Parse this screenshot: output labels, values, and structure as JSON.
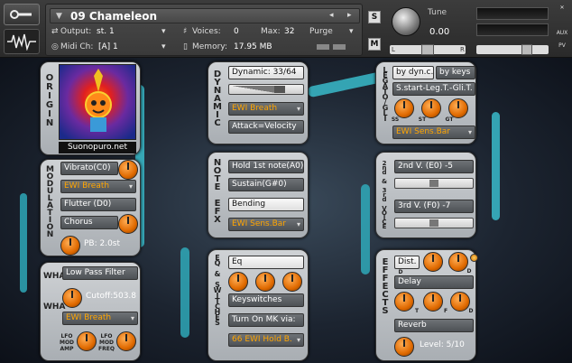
{
  "header": {
    "instrument_name": "09 Chameleon",
    "output_label": "Output:",
    "output_value": "st. 1",
    "midi_label": "Midi Ch:",
    "midi_value": "[A]  1",
    "voices_label": "Voices:",
    "voices_value": "0",
    "max_label": "Max:",
    "max_value": "32",
    "memory_label": "Memory:",
    "memory_value": "17.95 MB",
    "purge_label": "Purge",
    "solo_label": "S",
    "mute_label": "M",
    "tune_label": "Tune",
    "tune_value": "0.00",
    "pan_left": "L",
    "pan_right": "R",
    "aux_label": "AUX",
    "pv_label": "PV",
    "nav_prev": "◂",
    "nav_next": "▸"
  },
  "origin": {
    "title": "ORIGIN",
    "website": "Suonopuro.net"
  },
  "modulation": {
    "title": "MODULATION",
    "vibrato": "Vibrato(C0)",
    "ewi_breath": "EWI Breath",
    "flutter": "Flutter (D0)",
    "chorus": "Chorus",
    "pb": "PB:  2.0st"
  },
  "wha": {
    "title_1": "WHA",
    "title_2": "WHA",
    "low_pass_filter": "Low Pass Filter",
    "cutoff": "Cutoff:503.8",
    "ewi_breath": "EWI Breath",
    "lfo_mod_amp": "LFO MOD AMP",
    "lfo_mod_freq": "LFO MOD FREQ"
  },
  "dynamic": {
    "title": "DYNAMIC",
    "dynamic_value": "Dynamic: 33/64",
    "ewi_breath": "EWI Breath",
    "attack": "Attack=Velocity"
  },
  "note_efx": {
    "title": "NOTE EFX",
    "hold_1st_note": "Hold 1st note(A0)",
    "sustain": "Sustain(G#0)",
    "bending": "Bending",
    "ewi_sens_bar": "EWI Sens.Bar"
  },
  "eq_switches": {
    "title": "EQ & SWITCHES",
    "eq": "Eq",
    "keyswitches": "Keyswitches",
    "turn_on_mk": "Turn On MK via:",
    "ewi_hold": "66 EWI Hold B."
  },
  "legato": {
    "title": "LEGATO/GLI",
    "by_dyn": "by dyn.c.",
    "by_keys": "by keys",
    "mode": "S.start-Leg.T.-Gli.T.",
    "knob_ss": "SS",
    "knob_st": "ST",
    "knob_gt": "GT",
    "ewi_sens_bar": "EWI Sens.Bar"
  },
  "voice": {
    "title": "2nd & 3rd VOICE",
    "second": "2nd V. (E0) -5",
    "third": "3rd V. (F0) -7"
  },
  "effects": {
    "title": "EFFECTS",
    "dist": "Dist.",
    "delay": "Delay",
    "reverb": "Reverb",
    "level": "Level: 5/10",
    "knob_d1": "D",
    "knob_d2": "D",
    "knob_t": "T",
    "knob_f": "F",
    "knob_d3": "D"
  }
}
